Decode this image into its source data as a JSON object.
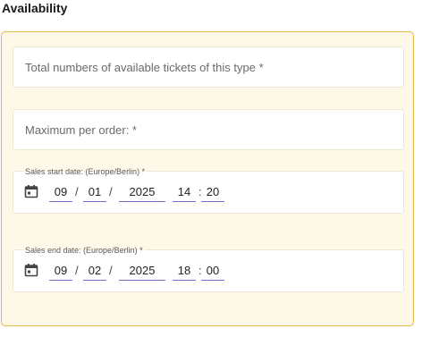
{
  "section": {
    "title": "Availability"
  },
  "fields": {
    "total_tickets": {
      "placeholder": "Total numbers of available tickets of this type *"
    },
    "max_per_order": {
      "placeholder": "Maximum per order: *"
    },
    "sales_start": {
      "label": "Sales start date: (Europe/Berlin) *",
      "month": "09",
      "day": "01",
      "year": "2025",
      "hour": "14",
      "minute": "20",
      "date_sep": "/",
      "time_sep": ":"
    },
    "sales_end": {
      "label": "Sales end date: (Europe/Berlin) *",
      "month": "09",
      "day": "02",
      "year": "2025",
      "hour": "18",
      "minute": "00",
      "date_sep": "/",
      "time_sep": ":"
    }
  },
  "icons": {
    "calendar": "calendar-icon"
  },
  "colors": {
    "panel_border": "#e3b84a",
    "panel_background": "#fdf8e8",
    "segment_underline": "#7b68c8"
  }
}
